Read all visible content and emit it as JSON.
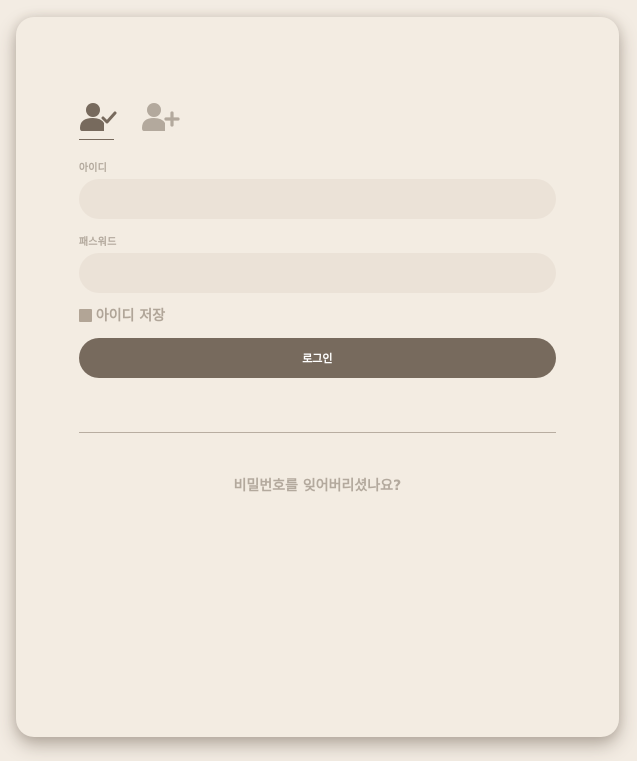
{
  "tabs": [
    {
      "name": "login",
      "icon": "user-check-icon",
      "color": "#776a5d",
      "active": true
    },
    {
      "name": "signup",
      "icon": "user-plus-icon",
      "color": "#b3a99d",
      "active": false
    }
  ],
  "form": {
    "id_label": "아이디",
    "id_value": "",
    "password_label": "패스워드",
    "password_value": "",
    "remember_label": "아이디 저장",
    "login_button": "로그인",
    "forgot_link": "비밀번호를 잊어버리셨나요?"
  },
  "colors": {
    "background": "#f3ece3",
    "card": "#f3ece2",
    "input": "#ebe2d7",
    "primary": "#776a5d",
    "muted": "#b3a99d"
  }
}
